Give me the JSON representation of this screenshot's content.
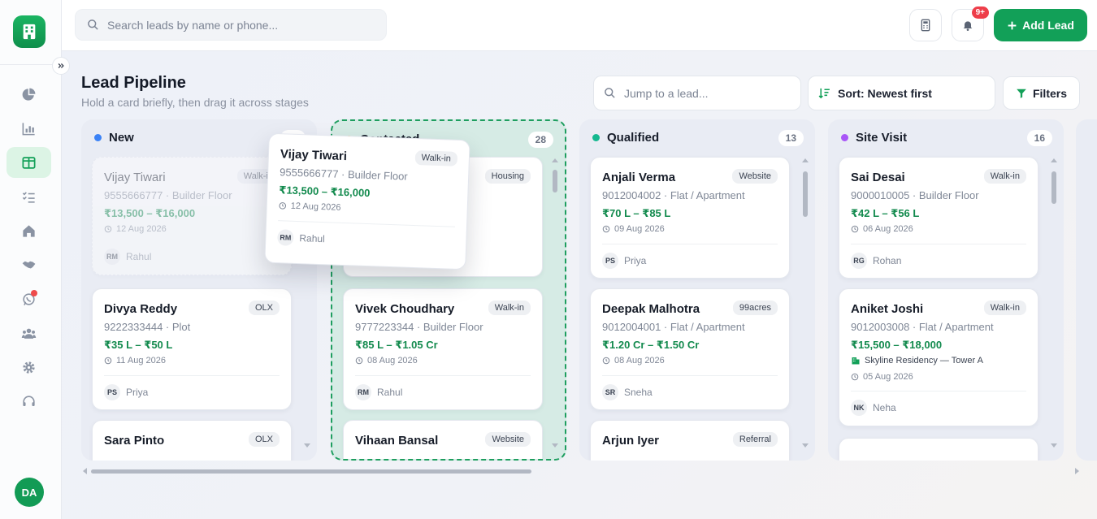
{
  "topbar": {
    "search_placeholder": "Search leads by name or phone...",
    "notification_count": "9+",
    "add_lead_label": "Add Lead"
  },
  "page": {
    "title": "Lead Pipeline",
    "subtitle": "Hold a card briefly, then drag it across stages",
    "jump_placeholder": "Jump to a lead...",
    "sort_label": "Sort: Newest first",
    "filters_label": "Filters"
  },
  "user": {
    "initials": "DA"
  },
  "colors": {
    "accent": "#12a058",
    "new": "#3b82f6",
    "contacted": "#f5a524",
    "qualified": "#14b88f",
    "site_visit": "#a855f7",
    "price": "#128a4d"
  },
  "columns": [
    {
      "title": "New",
      "count": "60",
      "cards": [
        {
          "name": "Vijay Tiwari",
          "tag": "Walk-in",
          "sub": "9555666777 · Builder Floor",
          "price": "₹13,500 – ₹16,000",
          "date": "12 Aug 2026",
          "owner_initials": "RM",
          "owner": "Rahul"
        },
        {
          "name": "Divya Reddy",
          "tag": "OLX",
          "sub": "9222333444 · Plot",
          "price": "₹35 L – ₹50 L",
          "date": "11 Aug 2026",
          "owner_initials": "PS",
          "owner": "Priya"
        },
        {
          "name": "Sara Pinto",
          "tag": "OLX"
        }
      ]
    },
    {
      "title": "Contacted",
      "count": "28",
      "cards": [
        {
          "tag": "Housing"
        },
        {
          "name": "Vivek Choudhary",
          "tag": "Walk-in",
          "sub": "9777223344 · Builder Floor",
          "price": "₹85 L – ₹1.05 Cr",
          "date": "08 Aug 2026",
          "owner_initials": "RM",
          "owner": "Rahul"
        },
        {
          "name": "Vihaan Bansal",
          "tag": "Website"
        }
      ]
    },
    {
      "title": "Qualified",
      "count": "13",
      "cards": [
        {
          "name": "Anjali Verma",
          "tag": "Website",
          "sub": "9012004002 · Flat / Apartment",
          "price": "₹70 L – ₹85 L",
          "date": "09 Aug 2026",
          "owner_initials": "PS",
          "owner": "Priya"
        },
        {
          "name": "Deepak Malhotra",
          "tag": "99acres",
          "sub": "9012004001 · Flat / Apartment",
          "price": "₹1.20 Cr – ₹1.50 Cr",
          "date": "08 Aug 2026",
          "owner_initials": "SR",
          "owner": "Sneha"
        },
        {
          "name": "Arjun Iyer",
          "tag": "Referral"
        }
      ]
    },
    {
      "title": "Site Visit",
      "count": "16",
      "cards": [
        {
          "name": "Sai Desai",
          "tag": "Walk-in",
          "sub": "9000010005 · Builder Floor",
          "price": "₹42 L – ₹56 L",
          "date": "06 Aug 2026",
          "owner_initials": "RG",
          "owner": "Rohan"
        },
        {
          "name": "Aniket Joshi",
          "tag": "Walk-in",
          "sub": "9012003008 · Flat / Apartment",
          "price": "₹15,500 – ₹18,000",
          "project": "Skyline Residency — Tower A",
          "date": "05 Aug 2026",
          "owner_initials": "NK",
          "owner": "Neha"
        }
      ]
    }
  ],
  "dragging_card": {
    "name": "Vijay Tiwari",
    "tag": "Walk-in",
    "sub": "9555666777 · Builder Floor",
    "price": "₹13,500 – ₹16,000",
    "date": "12 Aug 2026",
    "owner_initials": "RM",
    "owner": "Rahul"
  }
}
